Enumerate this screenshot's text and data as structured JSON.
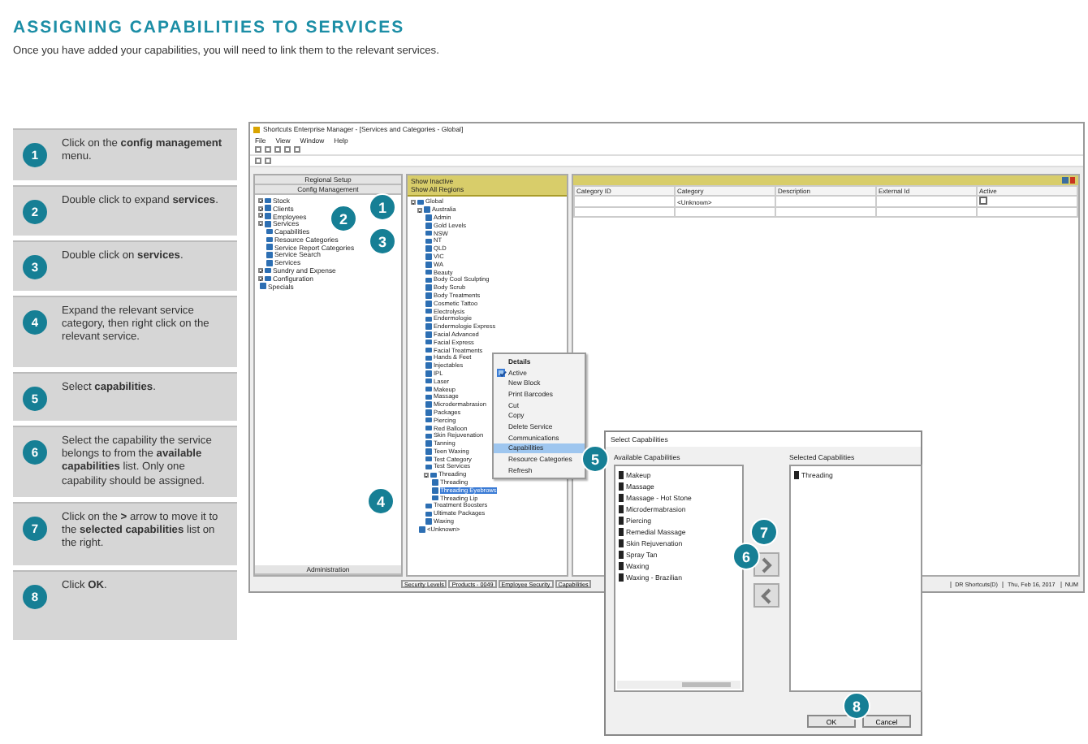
{
  "heading": "ASSIGNING CAPABILITIES TO SERVICES",
  "intro": "Once you have added your capabilities, you will need to link them to the relevant services.",
  "steps": [
    {
      "number": "1",
      "text": "Click on the **config management** menu."
    },
    {
      "number": "2",
      "text": "Double click to expand **services**."
    },
    {
      "number": "3",
      "text": "Double click on **services**."
    },
    {
      "number": "4",
      "text": "Expand the relevant service category, then right click on the relevant service."
    },
    {
      "number": "5",
      "text": "Select **capabilities**."
    },
    {
      "number": "6",
      "text": "Select the capability the service belongs to from the **available capabilities** list. Only one capability should be assigned."
    },
    {
      "number": "7",
      "text": "Click on the **>** arrow to move it to the **selected capabilities** list on the right."
    },
    {
      "number": "8",
      "text": "Click **OK**."
    }
  ],
  "app_window": {
    "title": "Shortcuts Enterprise Manager - [Services and Categories - Global]",
    "menu": [
      "File",
      "View",
      "Window",
      "Help"
    ],
    "left_pane": {
      "buttons": [
        "Regional Setup",
        "Config Management"
      ],
      "tree": [
        {
          "label": "Stock",
          "expanded": false
        },
        {
          "label": "Clients",
          "expanded": false
        },
        {
          "label": "Employees",
          "expanded": false
        },
        {
          "label": "Services",
          "expanded": true,
          "children": [
            {
              "label": "Capabilities"
            },
            {
              "label": "Resource Categories"
            },
            {
              "label": "Service Report Categories"
            },
            {
              "label": "Service Search"
            },
            {
              "label": "Services"
            }
          ]
        },
        {
          "label": "Sundry and Expense",
          "expanded": false
        },
        {
          "label": "Configuration",
          "expanded": false
        },
        {
          "label": "Specials"
        }
      ],
      "footer": "Administration"
    },
    "middle_pane": {
      "filters": [
        "Show Inactive",
        "Show All Regions"
      ],
      "tree": [
        {
          "label": "Global",
          "expanded": true,
          "selected": false,
          "children": [
            {
              "label": "Australia",
              "expanded": true,
              "selected": false,
              "children": [
                {
                  "label": "Admin",
                  "selected": false
                },
                {
                  "label": "Gold Levels",
                  "selected": false
                },
                {
                  "label": "NSW",
                  "selected": false
                },
                {
                  "label": "NT",
                  "selected": false
                },
                {
                  "label": "QLD",
                  "selected": false
                },
                {
                  "label": "VIC",
                  "selected": false
                },
                {
                  "label": "WA",
                  "selected": false
                },
                {
                  "label": "Beauty",
                  "selected": false
                },
                {
                  "label": "Body Cool Sculpting",
                  "selected": false
                },
                {
                  "label": "Body Scrub",
                  "selected": false
                },
                {
                  "label": "Body Treatments",
                  "selected": false
                },
                {
                  "label": "Cosmetic Tattoo",
                  "selected": false
                },
                {
                  "label": "Electrolysis",
                  "selected": false
                },
                {
                  "label": "Endermologie",
                  "selected": false
                },
                {
                  "label": "Endermologie Express",
                  "selected": false
                },
                {
                  "label": "Facial Advanced",
                  "selected": false
                },
                {
                  "label": "Facial Express",
                  "selected": false
                },
                {
                  "label": "Facial Treatments",
                  "selected": false
                },
                {
                  "label": "Hands & Feet",
                  "selected": false
                },
                {
                  "label": "Injectables",
                  "selected": false
                },
                {
                  "label": "IPL",
                  "selected": false
                },
                {
                  "label": "Laser",
                  "selected": false
                },
                {
                  "label": "Makeup",
                  "selected": false
                },
                {
                  "label": "Massage",
                  "selected": false
                },
                {
                  "label": "Microdermabrasion",
                  "selected": false
                },
                {
                  "label": "Packages",
                  "selected": false
                },
                {
                  "label": "Piercing",
                  "selected": false
                },
                {
                  "label": "Red Balloon",
                  "selected": false
                },
                {
                  "label": "Skin Rejuvenation",
                  "selected": false
                },
                {
                  "label": "Tanning",
                  "selected": false
                },
                {
                  "label": "Teen Waxing",
                  "selected": false
                },
                {
                  "label": "Test Category",
                  "selected": false
                },
                {
                  "label": "Test Services",
                  "selected": false
                },
                {
                  "label": "Threading",
                  "expanded": true,
                  "selected": false,
                  "children": [
                    {
                      "label": "Threading",
                      "selected": false
                    },
                    {
                      "label": "Threading Eyebrows",
                      "selected": true
                    },
                    {
                      "label": "Threading Lip",
                      "selected": false
                    }
                  ]
                },
                {
                  "label": "Treatment Boosters",
                  "selected": false
                },
                {
                  "label": "Ultimate Packages",
                  "selected": false
                },
                {
                  "label": "Waxing",
                  "selected": false
                }
              ]
            },
            {
              "label": "<Unknown>",
              "selected": false
            }
          ]
        }
      ]
    },
    "grid": {
      "columns": [
        "Category ID",
        "Category",
        "Description",
        "External Id",
        "Active"
      ],
      "rows": [
        {
          "category": "<Unknown>",
          "active": false
        }
      ]
    },
    "context_menu": [
      {
        "label": "Details",
        "kind": "header",
        "checked": false,
        "selected": false
      },
      {
        "label": "Active",
        "kind": "item",
        "checked": true,
        "selected": false
      },
      {
        "label": "New Block",
        "kind": "item",
        "checked": false,
        "selected": false
      },
      {
        "label": "Print Barcodes",
        "kind": "item",
        "checked": false,
        "selected": false
      },
      {
        "label": "Cut",
        "kind": "item",
        "checked": false,
        "selected": false
      },
      {
        "label": "Copy",
        "kind": "item",
        "checked": false,
        "selected": false
      },
      {
        "label": "Delete Service",
        "kind": "item",
        "checked": false,
        "selected": false
      },
      {
        "label": "Communications",
        "kind": "item",
        "checked": false,
        "selected": false
      },
      {
        "label": "Capabilities",
        "kind": "item",
        "checked": false,
        "selected": true
      },
      {
        "label": "Resource Categories",
        "kind": "item",
        "checked": false,
        "selected": false
      },
      {
        "label": "Refresh",
        "kind": "item",
        "checked": false,
        "selected": false
      }
    ],
    "status_tabs": [
      "Security Levels",
      "Products - 0049",
      "Employee Security",
      "Capabilities"
    ],
    "status_info": [
      "DR Shortcuts(D)",
      "Thu, Feb 16, 2017",
      "NUM"
    ]
  },
  "dialog": {
    "title": "Select Capabilities",
    "available_label": "Available Capabilities",
    "selected_label": "Selected Capabilities",
    "available": [
      "Makeup",
      "Massage",
      "Massage - Hot Stone",
      "Microdermabrasion",
      "Piercing",
      "Remedial Massage",
      "Skin Rejuvenation",
      "Spray Tan",
      "Waxing",
      "Waxing - Brazilian"
    ],
    "selected": [
      "Threading"
    ],
    "buttons": [
      "OK",
      "Cancel"
    ]
  },
  "badges": [
    "1",
    "2",
    "3",
    "4",
    "5",
    "6",
    "7",
    "8"
  ]
}
